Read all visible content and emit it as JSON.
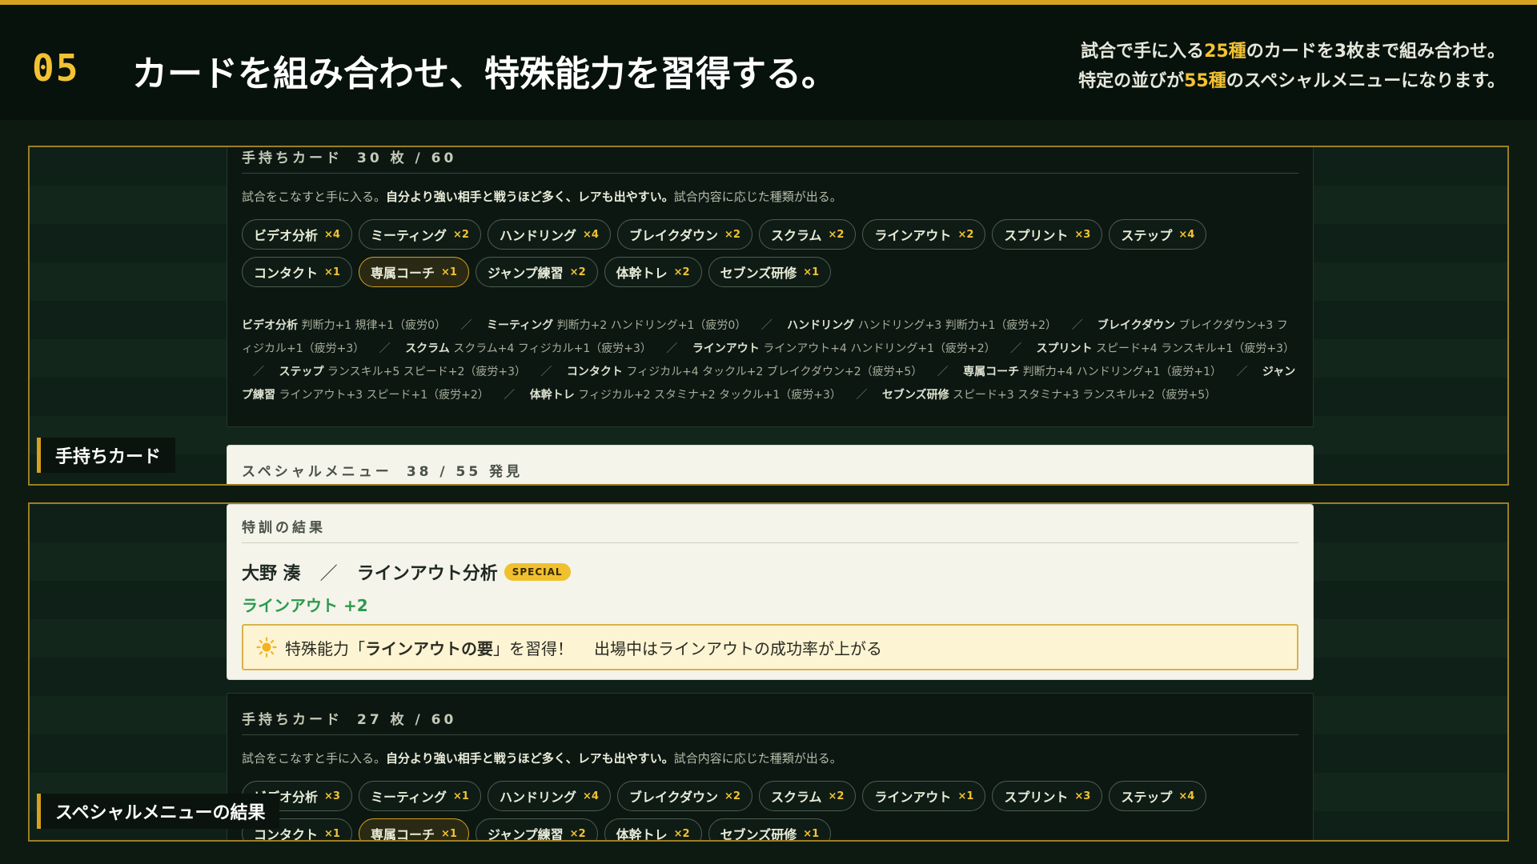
{
  "header": {
    "step": "05",
    "headline": "カードを組み合わせ、特殊能力を習得する。",
    "desc_line1": {
      "pre": "試合で手に入る",
      "hl": "25種",
      "post": "のカードを3枚まで組み合わせ。"
    },
    "desc_line2": {
      "pre": "特定の並びが",
      "hl": "55種",
      "post": "のスペシャルメニューになります。"
    }
  },
  "colors": {
    "accent": "#f2c232",
    "frame": "#9d7e24",
    "success": "#2a9a4e"
  },
  "section1": {
    "label": "手持ちカード",
    "panel": {
      "title": "手持ちカード",
      "count": "30 枚 / 60",
      "note_pre": "試合をこなすと手に入る。",
      "note_bold": "自分より強い相手と戦うほど多く、レアも出やすい。",
      "note_post": "試合内容に応じた種類が出る。",
      "chips": [
        {
          "name": "ビデオ分析",
          "count": "×4"
        },
        {
          "name": "ミーティング",
          "count": "×2"
        },
        {
          "name": "ハンドリング",
          "count": "×4"
        },
        {
          "name": "ブレイクダウン",
          "count": "×2"
        },
        {
          "name": "スクラム",
          "count": "×2"
        },
        {
          "name": "ラインアウト",
          "count": "×2"
        },
        {
          "name": "スプリント",
          "count": "×3"
        },
        {
          "name": "ステップ",
          "count": "×4"
        },
        {
          "name": "コンタクト",
          "count": "×1"
        },
        {
          "name": "専属コーチ",
          "count": "×1",
          "selected": true
        },
        {
          "name": "ジャンプ練習",
          "count": "×2"
        },
        {
          "name": "体幹トレ",
          "count": "×2"
        },
        {
          "name": "セブンズ研修",
          "count": "×1"
        }
      ],
      "effects": [
        {
          "name": "ビデオ分析",
          "text": "判断力+1 規律+1（疲労0）"
        },
        {
          "name": "ミーティング",
          "text": "判断力+2 ハンドリング+1（疲労0）"
        },
        {
          "name": "ハンドリング",
          "text": "ハンドリング+3 判断力+1（疲労+2）"
        },
        {
          "name": "ブレイクダウン",
          "text": "ブレイクダウン+3 フィジカル+1（疲労+3）"
        },
        {
          "name": "スクラム",
          "text": "スクラム+4 フィジカル+1（疲労+3）"
        },
        {
          "name": "ラインアウト",
          "text": "ラインアウト+4 ハンドリング+1（疲労+2）"
        },
        {
          "name": "スプリント",
          "text": "スピード+4 ランスキル+1（疲労+3）"
        },
        {
          "name": "ステップ",
          "text": "ランスキル+5 スピード+2（疲労+3）"
        },
        {
          "name": "コンタクト",
          "text": "フィジカル+4 タックル+2 ブレイクダウン+2（疲労+5）"
        },
        {
          "name": "専属コーチ",
          "text": "判断力+4 ハンドリング+1（疲労+1）"
        },
        {
          "name": "ジャンプ練習",
          "text": "ラインアウト+3 スピード+1（疲労+2）"
        },
        {
          "name": "体幹トレ",
          "text": "フィジカル+2 スタミナ+2 タックル+1（疲労+3）"
        },
        {
          "name": "セブンズ研修",
          "text": "スピード+3 スタミナ+3 ランスキル+2（疲労+5）"
        }
      ]
    },
    "special_menu": {
      "title": "スペシャルメニュー",
      "count": "38 / 55 発見"
    }
  },
  "section2": {
    "label": "スペシャルメニューの結果",
    "result": {
      "title": "特訓の結果",
      "player": "大野 湊",
      "separator": "／",
      "menu": "ラインアウト分析",
      "badge": "SPECIAL",
      "stat": "ラインアウト +2",
      "ability_icon": "sun-icon",
      "ability_pre": "特殊能力「",
      "ability_name": "ラインアウトの要",
      "ability_post": "」を習得！",
      "ability_effect": "出場中はラインアウトの成功率が上がる"
    },
    "panel": {
      "title": "手持ちカード",
      "count": "27 枚 / 60",
      "note_pre": "試合をこなすと手に入る。",
      "note_bold": "自分より強い相手と戦うほど多く、レアも出やすい。",
      "note_post": "試合内容に応じた種類が出る。",
      "chips": [
        {
          "name": "ビデオ分析",
          "count": "×3"
        },
        {
          "name": "ミーティング",
          "count": "×1"
        },
        {
          "name": "ハンドリング",
          "count": "×4"
        },
        {
          "name": "ブレイクダウン",
          "count": "×2"
        },
        {
          "name": "スクラム",
          "count": "×2"
        },
        {
          "name": "ラインアウト",
          "count": "×1"
        },
        {
          "name": "スプリント",
          "count": "×3"
        },
        {
          "name": "ステップ",
          "count": "×4"
        },
        {
          "name": "コンタクト",
          "count": "×1"
        },
        {
          "name": "専属コーチ",
          "count": "×1",
          "selected": true
        },
        {
          "name": "ジャンプ練習",
          "count": "×2"
        },
        {
          "name": "体幹トレ",
          "count": "×2"
        },
        {
          "name": "セブンズ研修",
          "count": "×1"
        }
      ]
    }
  }
}
